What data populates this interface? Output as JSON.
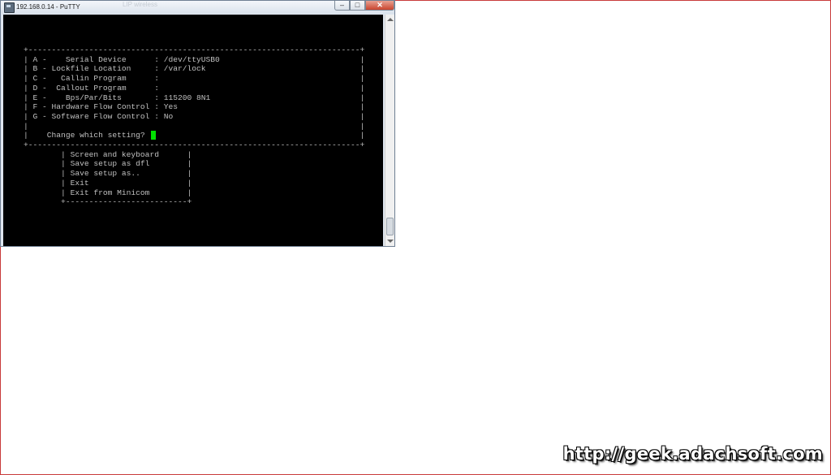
{
  "window": {
    "title": "192.168.0.14 - PuTTY",
    "ghost_text": "LIP wireless",
    "min_icon": "–",
    "max_icon": "□",
    "close_icon": "✕"
  },
  "terminal": {
    "lines": [
      "+-----------------------------------------------------------------------+",
      "| A -    Serial Device      : /dev/ttyUSB0                              |",
      "| B - Lockfile Location     : /var/lock                                 |",
      "| C -   Callin Program      :                                           |",
      "| D -  Callout Program      :                                           |",
      "| E -    Bps/Par/Bits       : 115200 8N1                                |",
      "| F - Hardware Flow Control : Yes                                       |",
      "| G - Software Flow Control : No                                        |",
      "|                                                                       |",
      "|    Change which setting?                                              |",
      "+-----------------------------------------------------------------------+",
      "        | Screen and keyboard      |",
      "        | Save setup as dfl        |",
      "        | Save setup as..          |",
      "        | Exit                     |",
      "        | Exit from Minicom        |",
      "        +--------------------------+"
    ],
    "cursor_color": "#00e000"
  },
  "watermark": "http://geek.adachsoft.com"
}
